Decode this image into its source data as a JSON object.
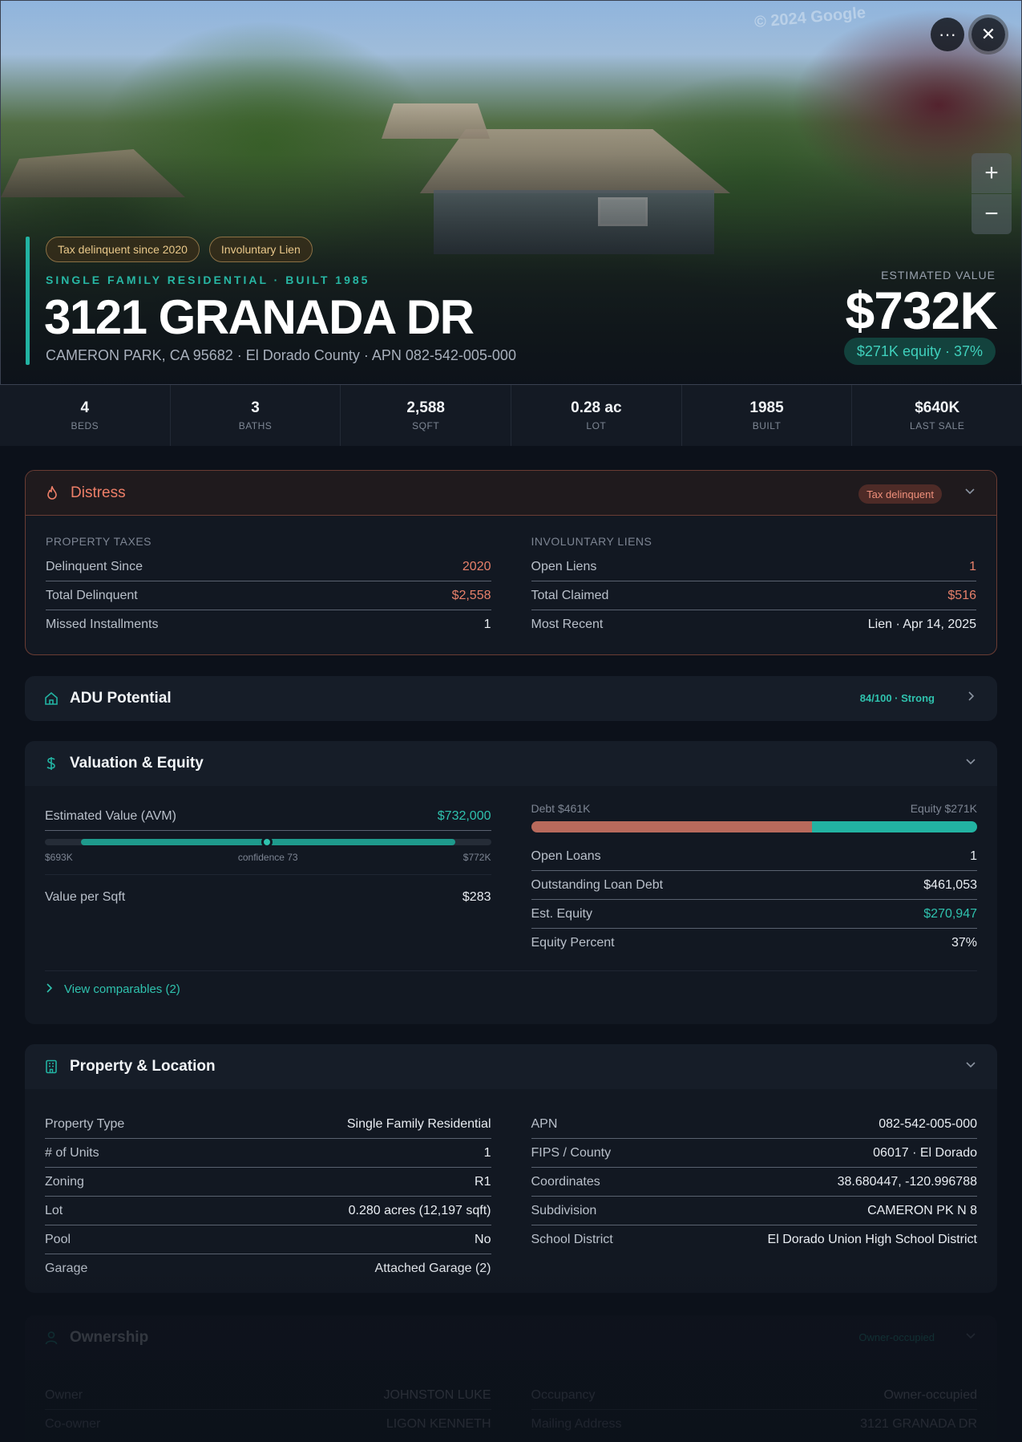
{
  "hero": {
    "watermark": "© 2024 Google",
    "badges": [
      "Tax delinquent since 2020",
      "Involuntary Lien"
    ],
    "subtitle": "SINGLE FAMILY RESIDENTIAL · BUILT 1985",
    "address": "3121 GRANADA DR",
    "address_sub": "CAMERON PARK, CA 95682 · El Dorado County · APN 082-542-005-000",
    "est_label": "ESTIMATED VALUE",
    "est_value": "$732K",
    "equity_pill": "$271K equity · 37%",
    "more_icon": "···",
    "close_icon": "✕",
    "zoom_in": "+",
    "zoom_out": "−"
  },
  "stats": [
    {
      "value": "4",
      "label": "BEDS"
    },
    {
      "value": "3",
      "label": "BATHS"
    },
    {
      "value": "2,588",
      "label": "SQFT"
    },
    {
      "value": "0.28 ac",
      "label": "LOT"
    },
    {
      "value": "1985",
      "label": "BUILT"
    },
    {
      "value": "$640K",
      "label": "LAST SALE"
    }
  ],
  "distress": {
    "title": "Distress",
    "tag": "Tax delinquent",
    "taxes_label": "PROPERTY TAXES",
    "taxes": [
      {
        "label": "Delinquent Since",
        "value": "2020"
      },
      {
        "label": "Total Delinquent",
        "value": "$2,558"
      },
      {
        "label": "Missed Installments",
        "value": "1"
      }
    ],
    "liens_label": "INVOLUNTARY LIENS",
    "liens": [
      {
        "label": "Open Liens",
        "value": "1"
      },
      {
        "label": "Total Claimed",
        "value": "$516"
      },
      {
        "label": "Most Recent",
        "value": "Lien · Apr 14, 2025"
      }
    ]
  },
  "adu": {
    "title": "ADU Potential",
    "score": "84/100 · Strong"
  },
  "valuation": {
    "title": "Valuation & Equity",
    "avm_label": "Estimated Value (AVM)",
    "avm_value": "$732,000",
    "avm_low": "$693K",
    "avm_confidence": "confidence 73",
    "avm_high": "$772K",
    "vps_label": "Value per Sqft",
    "vps_value": "$283",
    "debt_label": "Debt $461K",
    "equity_label": "Equity $271K",
    "debt_fraction": 0.63,
    "rows": [
      {
        "label": "Open Loans",
        "value": "1"
      },
      {
        "label": "Outstanding Loan Debt",
        "value": "$461,053"
      },
      {
        "label": "Est. Equity",
        "value": "$270,947"
      },
      {
        "label": "Equity Percent",
        "value": "37%"
      }
    ],
    "comps": "View comparables (2)"
  },
  "property": {
    "title": "Property & Location",
    "left": [
      {
        "label": "Property Type",
        "value": "Single Family Residential"
      },
      {
        "label": "# of Units",
        "value": "1"
      },
      {
        "label": "Zoning",
        "value": "R1"
      },
      {
        "label": "Lot",
        "value": "0.280 acres (12,197 sqft)"
      },
      {
        "label": "Pool",
        "value": "No"
      },
      {
        "label": "Garage",
        "value": "Attached Garage (2)"
      }
    ],
    "right": [
      {
        "label": "APN",
        "value": "082-542-005-000"
      },
      {
        "label": "FIPS / County",
        "value": "06017 · El Dorado"
      },
      {
        "label": "Coordinates",
        "value": "38.680447, -120.996788"
      },
      {
        "label": "Subdivision",
        "value": "CAMERON PK N 8"
      },
      {
        "label": "School District",
        "value": "El Dorado Union High School District"
      }
    ]
  },
  "ownership": {
    "title": "Ownership",
    "tag": "Owner-occupied",
    "left": [
      {
        "label": "Owner",
        "value": "JOHNSTON LUKE"
      },
      {
        "label": "Co-owner",
        "value": "LIGON KENNETH"
      }
    ],
    "right": [
      {
        "label": "Occupancy",
        "value": "Owner-occupied"
      },
      {
        "label": "Mailing Address",
        "value": "3121 GRANADA DR"
      }
    ]
  }
}
